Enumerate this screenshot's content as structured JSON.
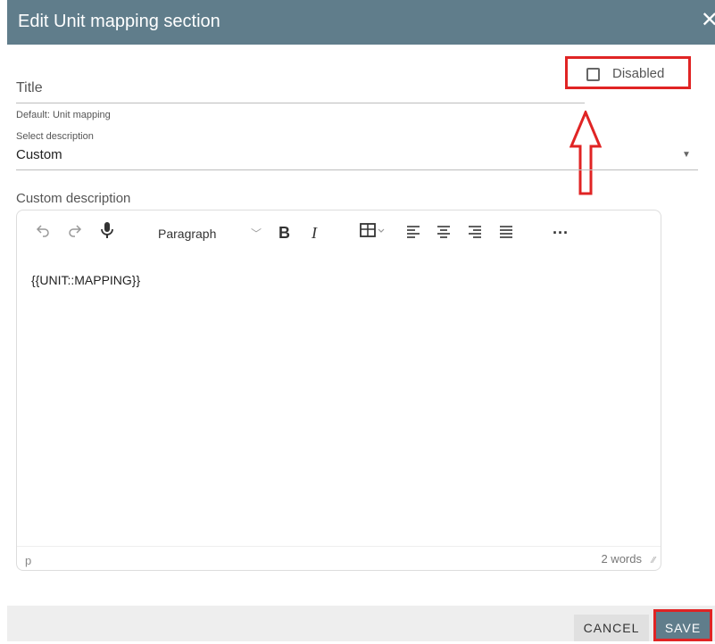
{
  "dialog": {
    "title": "Edit Unit mapping section",
    "close_glyph": "✕"
  },
  "title_field": {
    "label": "Title",
    "value": "",
    "hint": "Default: Unit mapping"
  },
  "disabled_checkbox": {
    "label": "Disabled",
    "checked": false
  },
  "description_select": {
    "label": "Select description",
    "value": "Custom"
  },
  "custom_description": {
    "label": "Custom description"
  },
  "editor": {
    "toolbar": {
      "block_format": "Paragraph"
    },
    "content": "{{UNIT::MAPPING}}",
    "status_path": "p",
    "word_count": "2 words"
  },
  "footer": {
    "cancel_label": "CANCEL",
    "save_label": "SAVE"
  },
  "colors": {
    "header": "#607d8b",
    "highlight": "#e02424",
    "save_button": "#607d8b"
  },
  "icons": [
    "close-icon",
    "undo-icon",
    "redo-icon",
    "microphone-icon",
    "chevron-down-icon",
    "bold-icon",
    "italic-icon",
    "table-icon",
    "align-left-icon",
    "align-center-icon",
    "align-right-icon",
    "align-justify-icon",
    "more-icon",
    "resize-grip-icon",
    "up-arrow-annotation"
  ]
}
